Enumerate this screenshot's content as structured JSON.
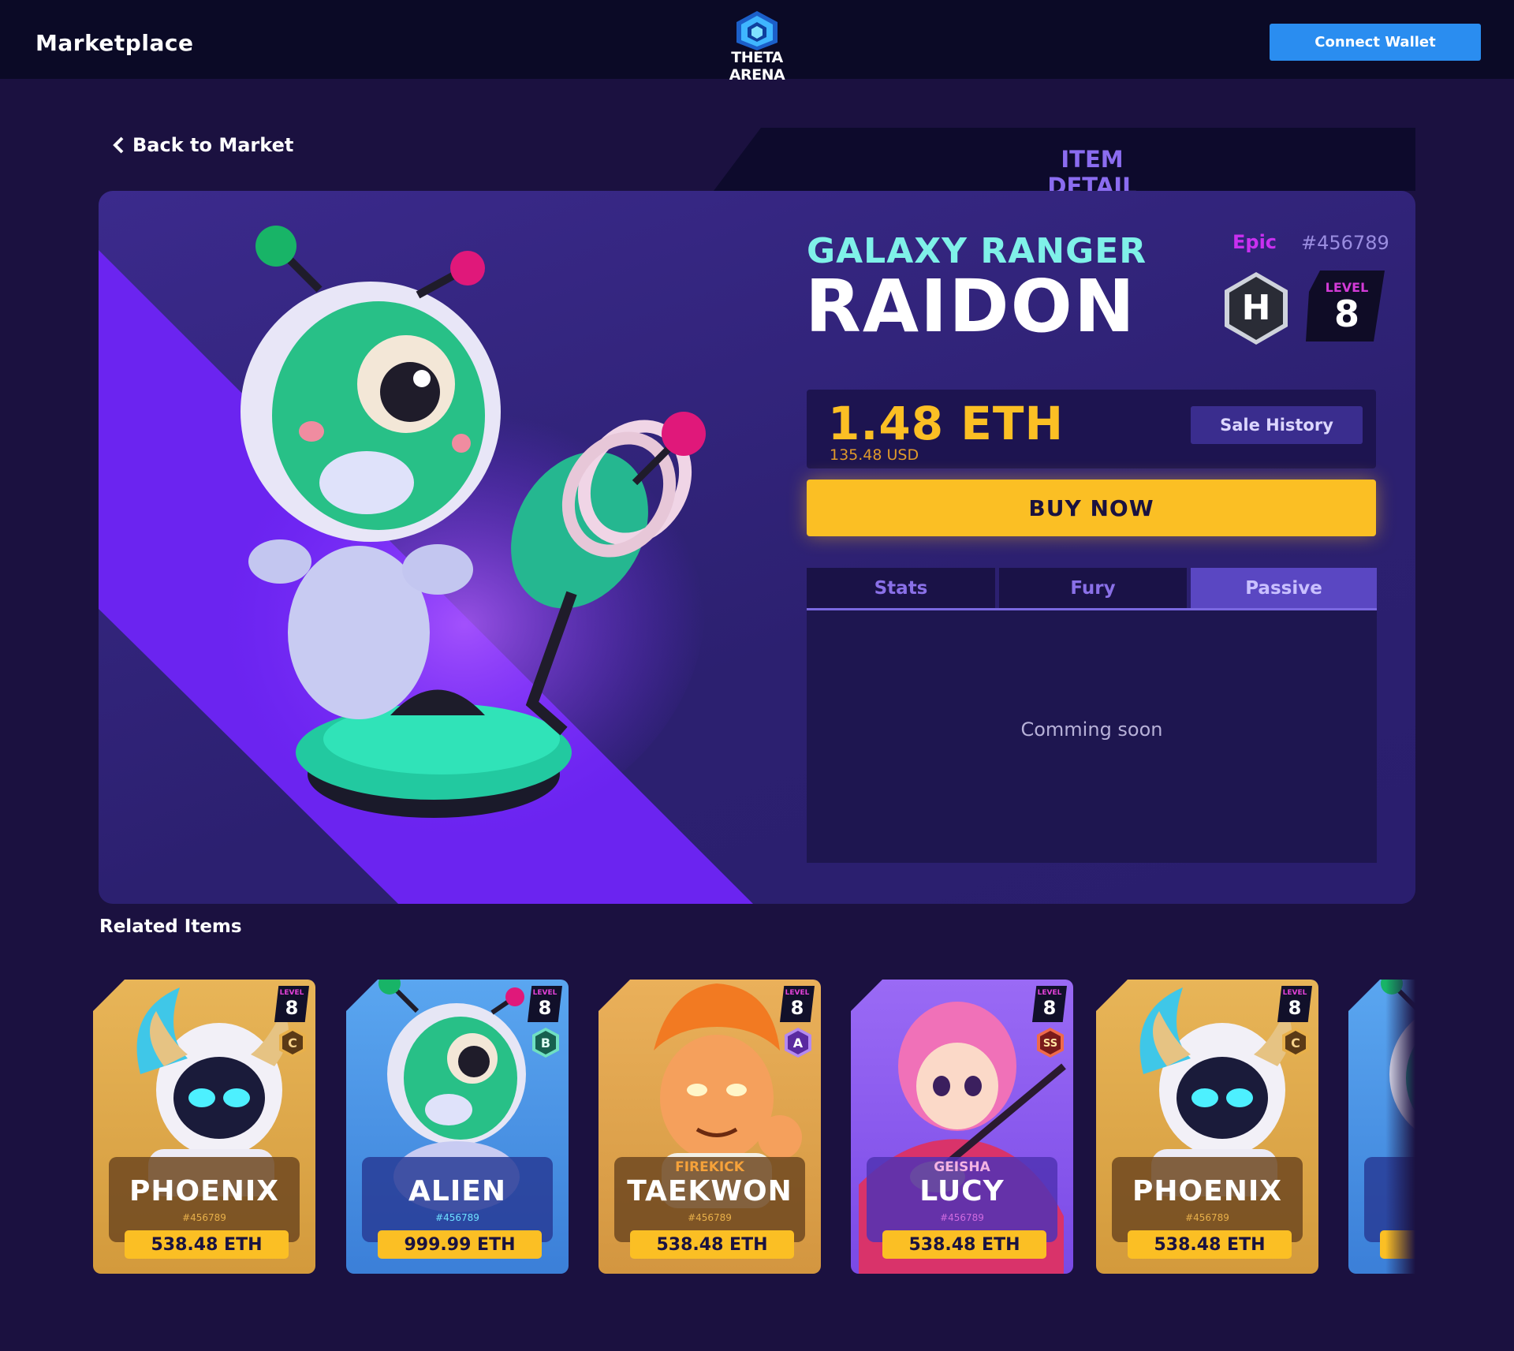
{
  "header": {
    "title": "Marketplace",
    "logo_text": "THETA ARENA",
    "connect_label": "Connect Wallet"
  },
  "nav": {
    "back_label": "Back to Market",
    "section_label": "ITEM DETAIL"
  },
  "item": {
    "subtitle": "GALAXY RANGER",
    "name": "RAIDON",
    "rarity": "Epic",
    "id": "#456789",
    "class_badge": "H",
    "level_label": "LEVEL",
    "level": "8",
    "price": "1.48 ETH",
    "price_usd": "135.48 USD",
    "sale_history_label": "Sale History",
    "buy_label": "BUY NOW",
    "tabs": [
      {
        "label": "Stats",
        "active": false
      },
      {
        "label": "Fury",
        "active": false
      },
      {
        "label": "Passive",
        "active": true
      }
    ],
    "tab_content": "Comming soon"
  },
  "related": {
    "title": "Related Items",
    "cards": [
      {
        "name": "PHOENIX",
        "tag": "",
        "id": "#456789",
        "price": "538.48 ETH",
        "level_label": "LEVEL",
        "level": "8",
        "rank": "C",
        "theme": "gold"
      },
      {
        "name": "ALIEN",
        "tag": "",
        "id": "#456789",
        "price": "999.99 ETH",
        "level_label": "LEVEL",
        "level": "8",
        "rank": "B",
        "theme": "blue"
      },
      {
        "name": "TAEKWON",
        "tag": "FIREKICK",
        "id": "#456789",
        "price": "538.48 ETH",
        "level_label": "LEVEL",
        "level": "8",
        "rank": "A",
        "theme": "gold"
      },
      {
        "name": "LUCY",
        "tag": "GEISHA",
        "id": "#456789",
        "price": "538.48 ETH",
        "level_label": "LEVEL",
        "level": "8",
        "rank": "SS",
        "theme": "purple"
      },
      {
        "name": "PHOENIX",
        "tag": "",
        "id": "#456789",
        "price": "538.48 ETH",
        "level_label": "LEVEL",
        "level": "8",
        "rank": "C",
        "theme": "gold"
      },
      {
        "name": "",
        "tag": "",
        "id": "",
        "price": "",
        "level_label": "",
        "level": "",
        "rank": "",
        "theme": "blue"
      }
    ]
  },
  "colors": {
    "background": "#1b1140",
    "topbar": "#0b0a26",
    "accent_blue": "#2a8df0",
    "accent_gold": "#fbbf24",
    "accent_cyan": "#7ff1e8",
    "accent_purple": "#8b6cf0",
    "rarity_epic": "#c930f0"
  },
  "icons": [
    "chevron-left-icon",
    "theta-arena-logo",
    "hero-class-hex-icon",
    "rank-hex-icon"
  ]
}
